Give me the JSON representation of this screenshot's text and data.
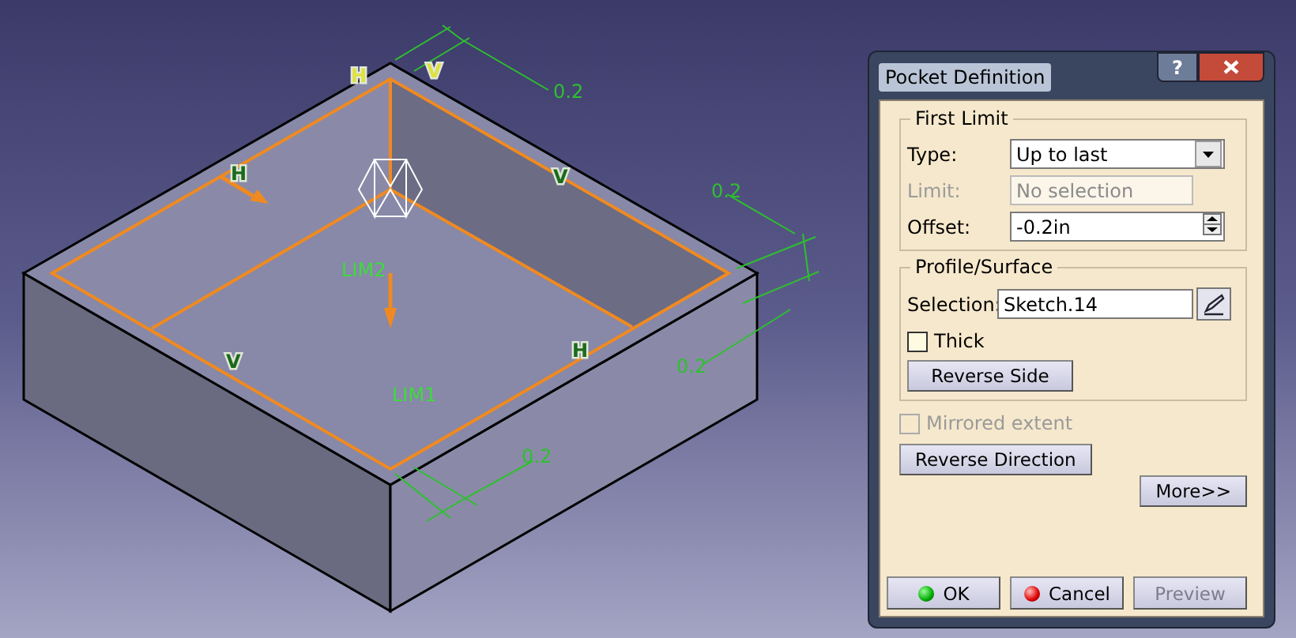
{
  "viewport": {
    "labels": [
      {
        "text": "0.2",
        "kind": "dimension"
      },
      {
        "text": "0.2",
        "kind": "dimension"
      },
      {
        "text": "0.2",
        "kind": "dimension"
      },
      {
        "text": "0.2",
        "kind": "dimension"
      },
      {
        "text": "H",
        "kind": "constraint",
        "color": "#e0e040"
      },
      {
        "text": "V",
        "kind": "constraint",
        "color": "#e0e040"
      },
      {
        "text": "H",
        "kind": "constraint",
        "color": "#1c6a1c"
      },
      {
        "text": "V",
        "kind": "constraint",
        "color": "#1c6a1c"
      },
      {
        "text": "V",
        "kind": "constraint",
        "color": "#1c6a1c"
      },
      {
        "text": "H",
        "kind": "constraint",
        "color": "#1c6a1c"
      },
      {
        "text": "LIM2",
        "kind": "limit"
      },
      {
        "text": "LIM1",
        "kind": "limit"
      }
    ]
  },
  "dialog": {
    "title": "Pocket Definition",
    "help_button": "?",
    "first_limit": {
      "title": "First Limit",
      "type": {
        "label": "Type:",
        "value": "Up to last"
      },
      "limit": {
        "label": "Limit:",
        "placeholder": "No selection",
        "disabled": true
      },
      "offset": {
        "label": "Offset:",
        "value": "-0.2in"
      }
    },
    "profile": {
      "title": "Profile/Surface",
      "selection": {
        "label": "Selection:",
        "value": "Sketch.14"
      },
      "thick": {
        "label": "Thick",
        "checked": false,
        "disabled": false
      },
      "reverse_side": "Reverse Side"
    },
    "mirrored": {
      "label": "Mirrored extent",
      "checked": false,
      "disabled": true
    },
    "reverse_direction": "Reverse Direction",
    "more": "More>>",
    "buttons": [
      {
        "label": "OK",
        "kind": "ok",
        "disabled": false
      },
      {
        "label": "Cancel",
        "kind": "cancel",
        "disabled": false
      },
      {
        "label": "Preview",
        "kind": "preview",
        "disabled": true
      }
    ]
  }
}
